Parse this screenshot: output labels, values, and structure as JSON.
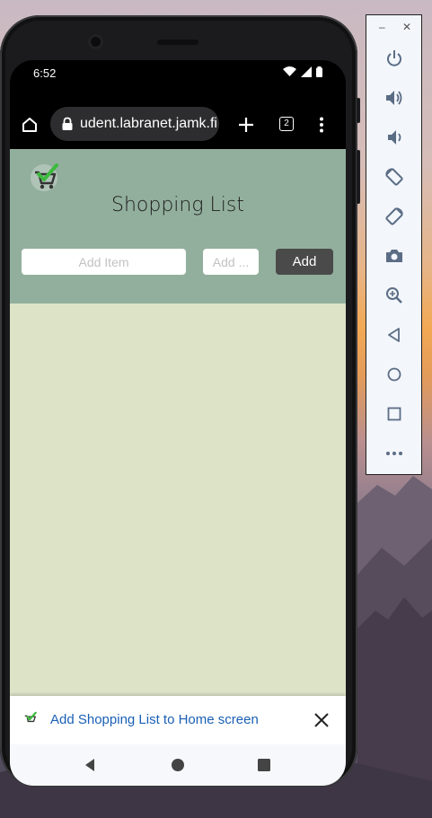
{
  "status_bar": {
    "time": "6:52"
  },
  "browser": {
    "url": "udent.labranet.jamk.fi",
    "tab_count": "2"
  },
  "app": {
    "title": "Shopping List",
    "item_placeholder": "Add Item",
    "count_placeholder": "Add ...",
    "add_button": "Add",
    "header_color": "#92af9d",
    "content_color": "#dce3c7"
  },
  "install_banner": {
    "text": "Add Shopping List to Home screen"
  },
  "emulator_panel": {
    "items": [
      "power-icon",
      "volume-up-icon",
      "volume-down-icon",
      "rotate-left-icon",
      "rotate-right-icon",
      "camera-icon",
      "zoom-icon",
      "back-icon",
      "home-icon",
      "overview-icon",
      "more-icon"
    ]
  }
}
